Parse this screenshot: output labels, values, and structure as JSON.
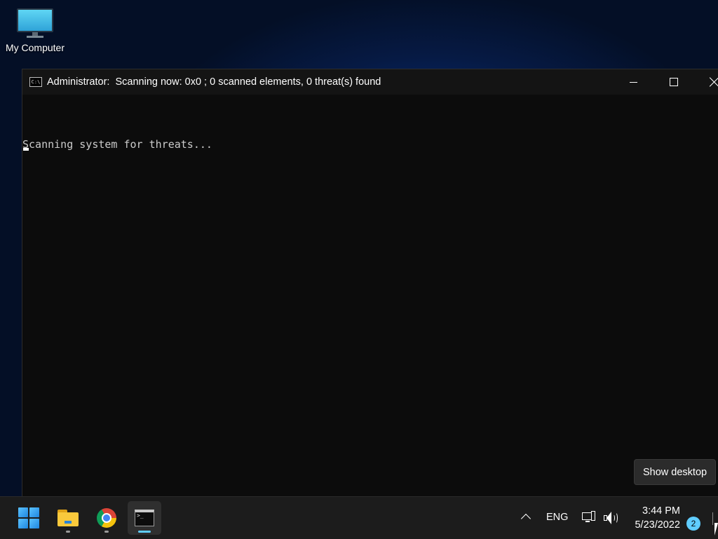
{
  "desktop": {
    "icons": [
      {
        "label": "My Computer",
        "icon": "monitor-icon"
      }
    ]
  },
  "window": {
    "icon": "command-prompt-icon",
    "title": "Administrator:  Scanning now: 0x0 ; 0 scanned elements, 0 threat(s) found",
    "controls": {
      "minimize": "minimize-icon",
      "maximize": "maximize-icon",
      "close": "close-icon"
    },
    "console_lines": [
      "Scanning system for threats..."
    ]
  },
  "tooltip": {
    "text": "Show desktop"
  },
  "taskbar": {
    "apps": [
      {
        "name": "Start",
        "icon": "windows-logo-icon",
        "active": false
      },
      {
        "name": "File Explorer",
        "icon": "folder-icon",
        "active": false
      },
      {
        "name": "Google Chrome",
        "icon": "chrome-icon",
        "active": false
      },
      {
        "name": "Command Prompt",
        "icon": "command-prompt-icon",
        "active": true
      }
    ],
    "tray": {
      "language": "ENG",
      "time": "3:44 PM",
      "date": "5/23/2022",
      "notification_count": "2"
    }
  },
  "colors": {
    "accent": "#60cdff",
    "console_bg": "#0c0c0c",
    "console_text": "#cccccc",
    "taskbar_bg": "#1c1c1c"
  }
}
